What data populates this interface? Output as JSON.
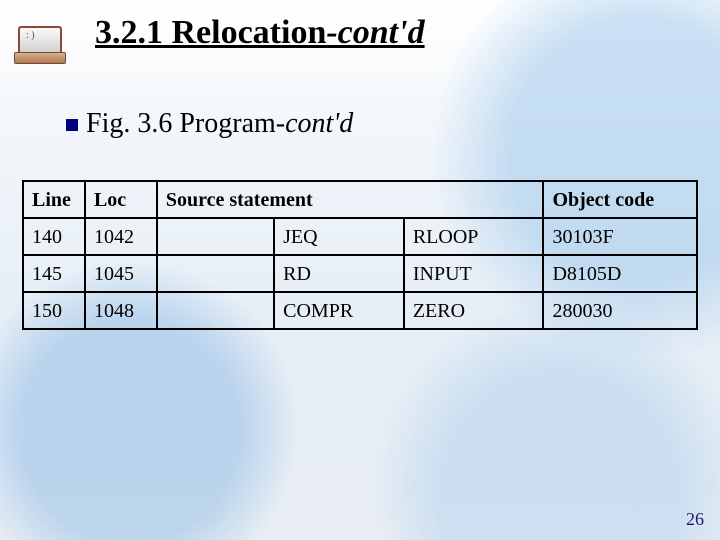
{
  "title": {
    "main": "3.2.1 Relocation",
    "suffix": "-cont'd"
  },
  "subtitle": {
    "prefix": "Fig. 3.6 Program",
    "suffix": "-cont'd"
  },
  "table": {
    "headers": {
      "line": "Line",
      "loc": "Loc",
      "source": "Source statement",
      "object": "Object code"
    },
    "rows": [
      {
        "line": "140",
        "loc": "1042",
        "label": "",
        "mnemonic": "JEQ",
        "operand": "RLOOP",
        "object": "30103F"
      },
      {
        "line": "145",
        "loc": "1045",
        "label": "",
        "mnemonic": "RD",
        "operand": "INPUT",
        "object": "D8105D"
      },
      {
        "line": "150",
        "loc": "1048",
        "label": "",
        "mnemonic": "COMPR",
        "operand": "ZERO",
        "object": "280030"
      }
    ]
  },
  "page_number": "26"
}
